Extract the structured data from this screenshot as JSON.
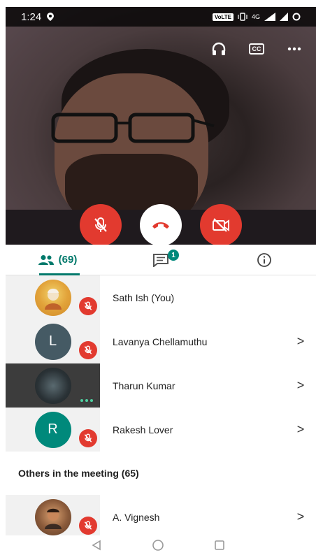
{
  "status_bar": {
    "time": "1:24",
    "network": "VoLTE",
    "data": "4G"
  },
  "video": {
    "icons": [
      "headphones-icon",
      "closed-captions-icon",
      "more-options-icon"
    ],
    "cc_label": "CC"
  },
  "controls": {
    "mic": "mic-off-icon",
    "end_call": "end-call-icon",
    "camera": "camera-off-icon",
    "colors": {
      "red": "#e23a2f",
      "white": "#ffffff"
    }
  },
  "tabs": {
    "people_count": "(69)",
    "chat_badge": "1",
    "accent": "#00796b"
  },
  "participants": [
    {
      "name": "Sath Ish (You)",
      "avatar": "photo",
      "muted": true,
      "chevron": false
    },
    {
      "name": "Lavanya Chellamuthu",
      "initial": "L",
      "avatar_color": "#455a64",
      "muted": true,
      "chevron": true
    },
    {
      "name": "Tharun Kumar",
      "avatar": "video",
      "muted": false,
      "speaking": true,
      "chevron": true
    },
    {
      "name": "Rakesh Lover",
      "initial": "R",
      "avatar_color": "#00897b",
      "muted": true,
      "chevron": true
    }
  ],
  "others": {
    "title": "Others in the meeting (65)",
    "items": [
      {
        "name": "A. Vignesh",
        "avatar": "photo",
        "muted": true,
        "chevron": true
      }
    ]
  },
  "chevron": ">"
}
